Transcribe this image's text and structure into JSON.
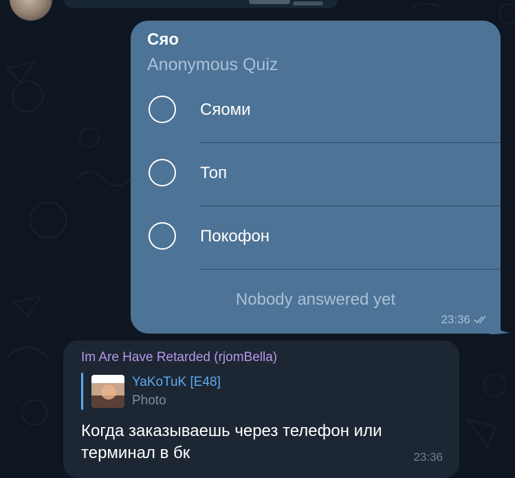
{
  "poll": {
    "question": "Сяо",
    "type": "Anonymous Quiz",
    "options": [
      {
        "label": "Сяоми"
      },
      {
        "label": "Топ"
      },
      {
        "label": "Покофон"
      }
    ],
    "status": "Nobody answered yet",
    "time": "23:36"
  },
  "message": {
    "sender": "Im Are Have Retarded (rjomBella)",
    "reply": {
      "author": "YaKoTuK [E48]",
      "type": "Photo"
    },
    "text": "Когда заказываешь через телефон или терминал в бк",
    "time": "23:36"
  },
  "colors": {
    "background": "#0e1621",
    "outgoing_bubble": "#4d7396",
    "incoming_bubble": "#1c2733",
    "sender_name": "#b898e9",
    "reply_accent": "#5eaaf0"
  }
}
